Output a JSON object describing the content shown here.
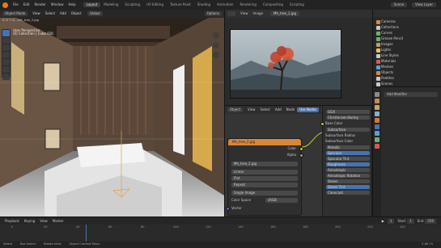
{
  "menubar": {
    "menus": [
      "File",
      "Edit",
      "Render",
      "Window",
      "Help"
    ],
    "workspaces": [
      "Layout",
      "Modeling",
      "Sculpting",
      "UV Editing",
      "Texture Paint",
      "Shading",
      "Animation",
      "Rendering",
      "Compositing",
      "Scripting"
    ],
    "active_workspace": "Layout",
    "scene_label": "Scene",
    "view_layer_label": "View Layer"
  },
  "viewport": {
    "mode": "Object Mode",
    "menus": [
      "View",
      "Select",
      "Add",
      "Object"
    ],
    "orientation": "Global",
    "options_label": "Options",
    "info_lines": [
      "User Perspective",
      "(0) Collection | Cube.016"
    ],
    "path_readout": "E:\\3 7.3\\...\\Mh_tree_2.jpg"
  },
  "image_editor": {
    "menus": [
      "View",
      "Image"
    ],
    "image_name": "Mh_tree_2.jpg"
  },
  "node_editor": {
    "editor_type": "Object",
    "menus": [
      "View",
      "Select",
      "Add",
      "Node"
    ],
    "use_nodes_label": "Use Nodes",
    "slot_label": "Slot 1",
    "texture_node": {
      "title": "Mh_tree_2.jpg",
      "outputs": [
        "Color",
        "Alpha"
      ],
      "image_field": "Mh_tree_2.jpg",
      "interpolation": "Linear",
      "projection": "Flat",
      "extension": "Repeat",
      "source": "Single Image",
      "color_space_label": "Color Space",
      "color_space": "sRGB",
      "vector_label": "Vector"
    },
    "bsdf_node": {
      "distribution": "GGX",
      "subsurface_method": "Christensen-Burley",
      "inputs": [
        "Base Color",
        "Subsurface",
        "Subsurface Radius",
        "Subsurface Color",
        "Metallic",
        "Specular",
        "Specular Tint",
        "Roughness",
        "Anisotropic",
        "Anisotropic Rotation",
        "Sheen",
        "Sheen Tint",
        "Clearcoat"
      ]
    }
  },
  "outliner": {
    "rows": [
      {
        "label": "Cameras",
        "color": "#d48a45"
      },
      {
        "label": "Collections",
        "color": "#c9c9c9"
      },
      {
        "label": "Curves",
        "color": "#6fb06f"
      },
      {
        "label": "Grease Pencil",
        "color": "#6fb06f"
      },
      {
        "label": "Images",
        "color": "#c49a6c"
      },
      {
        "label": "Lights",
        "color": "#e6c35b"
      },
      {
        "label": "Line Styles",
        "color": "#c9c9c9"
      },
      {
        "label": "Materials",
        "color": "#d35a5a"
      },
      {
        "label": "Meshes",
        "color": "#5aa0d3"
      },
      {
        "label": "Objects",
        "color": "#d48a45"
      },
      {
        "label": "Palettes",
        "color": "#c9c9c9"
      },
      {
        "label": "Scenes",
        "color": "#c9c9c9"
      }
    ]
  },
  "properties": {
    "add_modifier_label": "Add Modifier"
  },
  "timeline": {
    "menus": [
      "Playback",
      "Keying",
      "View",
      "Marker"
    ],
    "current_frame": "1",
    "start_label": "Start",
    "start": "1",
    "end_label": "End",
    "end": "250",
    "ticks": [
      "0",
      "20",
      "40",
      "60",
      "80",
      "100",
      "120",
      "140",
      "160",
      "180",
      "200",
      "220",
      "240"
    ]
  },
  "statusbar": {
    "items": [
      "Select",
      "Box Select",
      "Rotate View",
      "Object Context Menu"
    ],
    "version": "2.80.75"
  },
  "colors": {
    "accent": "#4772b3",
    "node_header_texture": "#d9863b",
    "node_header_shader": "#3c7f4c"
  }
}
